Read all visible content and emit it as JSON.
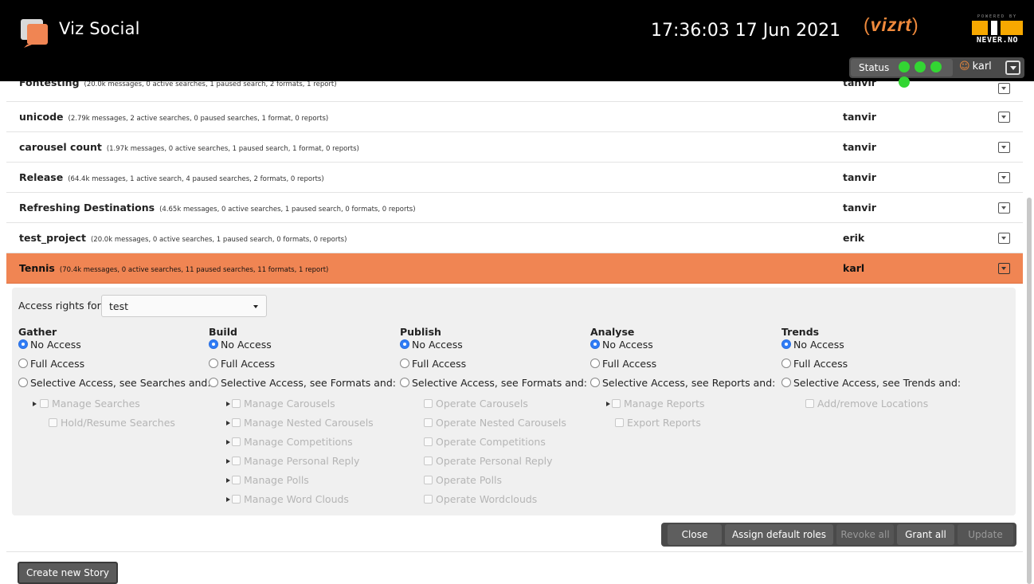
{
  "header": {
    "app_title": "Viz Social",
    "clock": "17:36:03 17 Jun 2021",
    "brand": "vizrt",
    "partner_powered": "POWERED BY",
    "partner": "NEVER.NO",
    "status_label": "Status",
    "user": "karl",
    "accent_color": "#f08553",
    "status_color": "#33d633"
  },
  "stories": [
    {
      "name": "Fontesting",
      "meta": "(20.0k messages, 0 active searches, 1 paused search, 2 formats, 1 report)",
      "owner": "tanvir"
    },
    {
      "name": "unicode",
      "meta": "(2.79k messages, 2 active searches, 0 paused searches, 1 format, 0 reports)",
      "owner": "tanvir"
    },
    {
      "name": "carousel count",
      "meta": "(1.97k messages, 0 active searches, 1 paused search, 1 format, 0 reports)",
      "owner": "tanvir"
    },
    {
      "name": "Release",
      "meta": "(64.4k messages, 1 active search, 4 paused searches, 2 formats, 0 reports)",
      "owner": "tanvir"
    },
    {
      "name": "Refreshing Destinations",
      "meta": "(4.65k messages, 0 active searches, 1 paused search, 0 formats, 0 reports)",
      "owner": "tanvir"
    },
    {
      "name": "test_project",
      "meta": "(20.0k messages, 0 active searches, 1 paused search, 0 formats, 0 reports)",
      "owner": "erik"
    },
    {
      "name": "Tennis",
      "meta": "(70.4k messages, 0 active searches, 11 paused searches, 11 formats, 1 report)",
      "owner": "karl"
    }
  ],
  "access": {
    "label": "Access rights for",
    "selected_role": "test",
    "columns": [
      {
        "title": "Gather",
        "no_access": "No Access",
        "full_access": "Full Access",
        "selective": "Selective Access, see Searches and:",
        "items": [
          {
            "label": "Manage Searches",
            "expandable": true
          },
          {
            "label": "Hold/Resume Searches",
            "expandable": false
          }
        ]
      },
      {
        "title": "Build",
        "no_access": "No Access",
        "full_access": "Full Access",
        "selective": "Selective Access, see Formats and:",
        "items": [
          {
            "label": "Manage Carousels",
            "expandable": true
          },
          {
            "label": "Manage Nested Carousels",
            "expandable": true
          },
          {
            "label": "Manage Competitions",
            "expandable": true
          },
          {
            "label": "Manage Personal Reply",
            "expandable": true
          },
          {
            "label": "Manage Polls",
            "expandable": true
          },
          {
            "label": "Manage Word Clouds",
            "expandable": true
          }
        ]
      },
      {
        "title": "Publish",
        "no_access": "No Access",
        "full_access": "Full Access",
        "selective": "Selective Access, see Formats and:",
        "items": [
          {
            "label": "Operate Carousels",
            "expandable": false
          },
          {
            "label": "Operate Nested Carousels",
            "expandable": false
          },
          {
            "label": "Operate Competitions",
            "expandable": false
          },
          {
            "label": "Operate Personal Reply",
            "expandable": false
          },
          {
            "label": "Operate Polls",
            "expandable": false
          },
          {
            "label": "Operate Wordclouds",
            "expandable": false
          }
        ]
      },
      {
        "title": "Analyse",
        "no_access": "No Access",
        "full_access": "Full Access",
        "selective": "Selective Access, see Reports and:",
        "items": [
          {
            "label": "Manage Reports",
            "expandable": true
          },
          {
            "label": "Export Reports",
            "expandable": false
          }
        ]
      },
      {
        "title": "Trends",
        "no_access": "No Access",
        "full_access": "Full Access",
        "selective": "Selective Access, see Trends and:",
        "items": [
          {
            "label": "Add/remove Locations",
            "expandable": false
          }
        ]
      }
    ]
  },
  "actions": {
    "close": "Close",
    "assign_default": "Assign default roles",
    "revoke_all": "Revoke all",
    "grant_all": "Grant all",
    "update": "Update"
  },
  "create_story": "Create new Story"
}
